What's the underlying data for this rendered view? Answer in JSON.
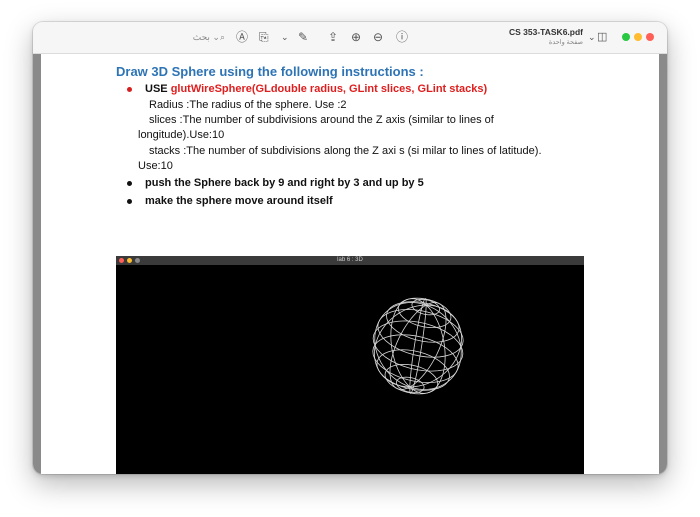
{
  "toolbar": {
    "search_placeholder": "بحث",
    "doc_title": "CS 353-TASK6.pdf",
    "doc_subtitle": "صفحة واحدة"
  },
  "colors": {
    "heading": "#2e74b5",
    "function_red": "#e01e1e",
    "traffic_red": "#ff5f57",
    "traffic_yellow": "#febc2e",
    "traffic_green": "#28c840"
  },
  "document": {
    "heading": "Draw 3D Sphere using the following instructions :",
    "items": [
      {
        "prefix": "USE ",
        "highlight": "glutWireSphere(GLdouble radius, GLint slices, GLint stacks)"
      },
      {
        "text": "Radius :The radius of the sphere. Use :2"
      },
      {
        "text": "slices :The number of subdivisions around the Z axis (similar to lines of"
      },
      {
        "text": "longitude).Use:10"
      },
      {
        "text": "stacks :The number of subdivisions along the Z axi s (si milar to lines of latitude)."
      },
      {
        "text": "Use:10"
      },
      {
        "text": "push the Sphere back by 9 and right by 3 and up by 5"
      },
      {
        "text": "make the sphere move around itself"
      }
    ]
  },
  "gl_window": {
    "title": "lab 6 : 3D"
  }
}
